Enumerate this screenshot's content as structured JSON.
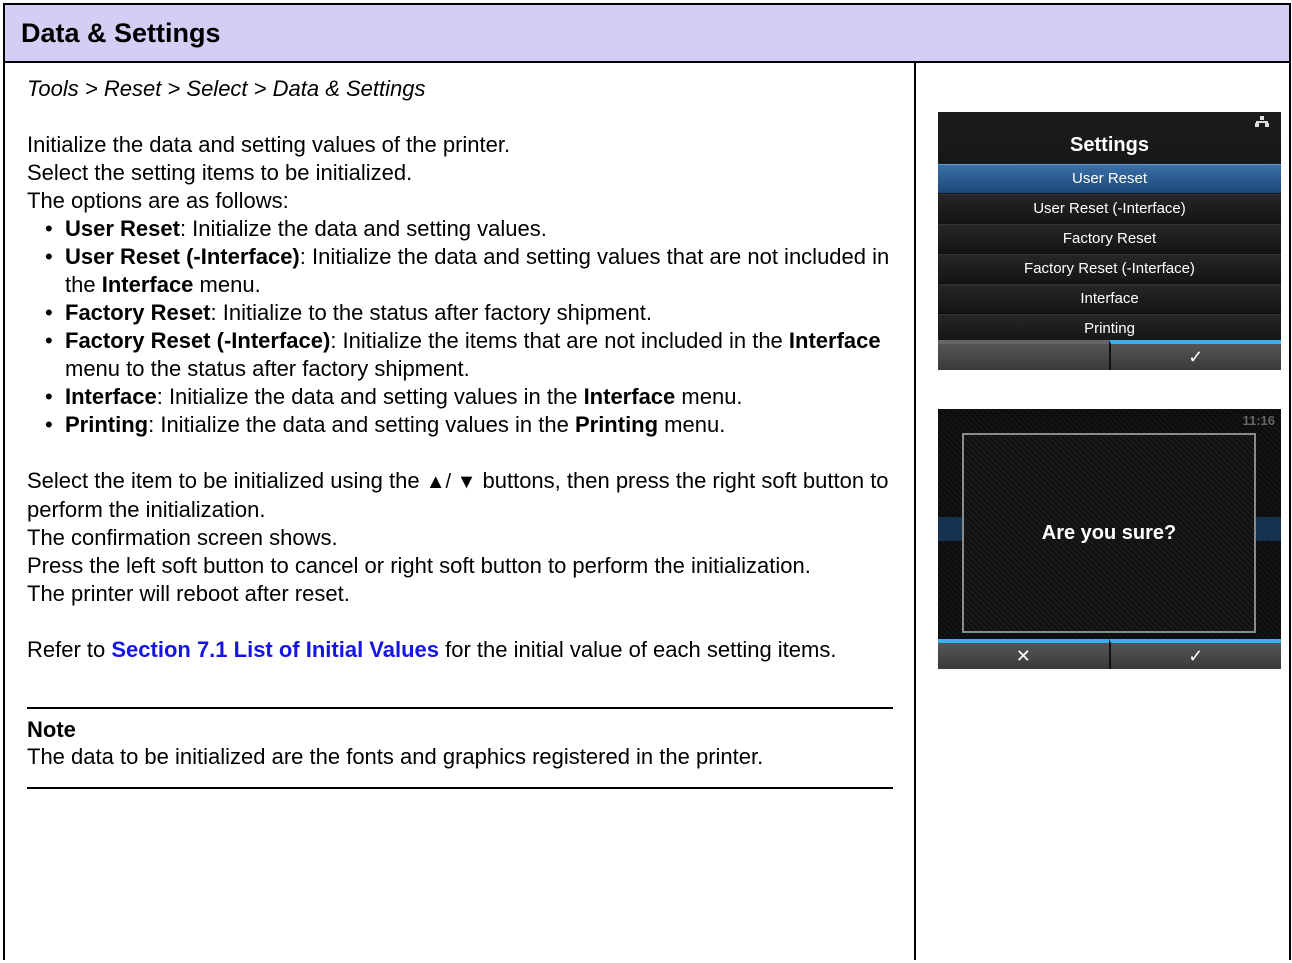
{
  "page": {
    "title": "Data & Settings",
    "breadcrumb": "Tools > Reset > Select > Data & Settings"
  },
  "intro": [
    "Initialize the data and setting values of the printer.",
    "Select the setting items to be initialized.",
    "The options are as follows:"
  ],
  "options": [
    {
      "name": "User Reset",
      "desc_pre": ": Initialize the data and setting values.",
      "bold2": "",
      "desc_post": ""
    },
    {
      "name": "User Reset (-Interface)",
      "desc_pre": ": Initialize the data and setting values that are not included in the ",
      "bold2": "Interface",
      "desc_post": " menu."
    },
    {
      "name": "Factory Reset",
      "desc_pre": ": Initialize to the status after factory shipment.",
      "bold2": "",
      "desc_post": ""
    },
    {
      "name": "Factory Reset (-Interface)",
      "desc_pre": ": Initialize the items that are not included in the ",
      "bold2": "Interface",
      "desc_post": " menu to the status after factory shipment."
    },
    {
      "name": "Interface",
      "desc_pre": ": Initialize the data and setting values in the ",
      "bold2": "Interface",
      "desc_post": " menu."
    },
    {
      "name": "Printing",
      "desc_pre": ": Initialize the data and setting values in the ",
      "bold2": "Printing",
      "desc_post": " menu."
    }
  ],
  "instructions": {
    "select_pre": "Select the item to be initialized using the ",
    "arrows": "▲/ ▼",
    "select_post": " buttons, then press the right soft button to perform the initialization.",
    "confirm": "The confirmation screen shows.",
    "press": "Press the left soft button to cancel or right soft button to perform the initialization.",
    "reboot": "The printer will reboot after reset."
  },
  "refer": {
    "pre": "Refer to ",
    "link": "Section 7.1 List of Initial Values",
    "post": " for the initial value of each setting items."
  },
  "note": {
    "title": "Note",
    "text": "The data to be initialized are the fonts and graphics registered in the printer."
  },
  "screen1": {
    "title": "Settings",
    "items": [
      "User Reset",
      "User Reset (-Interface)",
      "Factory Reset",
      "Factory Reset (-Interface)",
      "Interface",
      "Printing"
    ],
    "right_soft": "✓"
  },
  "screen2": {
    "time": "11:16",
    "dialog": "Are you sure?",
    "left_soft": "✕",
    "right_soft": "✓"
  },
  "colors": {
    "header_bg": "#d6cdf5",
    "link": "#1414e6",
    "lcd_selected": "#2a5c92",
    "softbar_accent": "#3ab0f0"
  }
}
